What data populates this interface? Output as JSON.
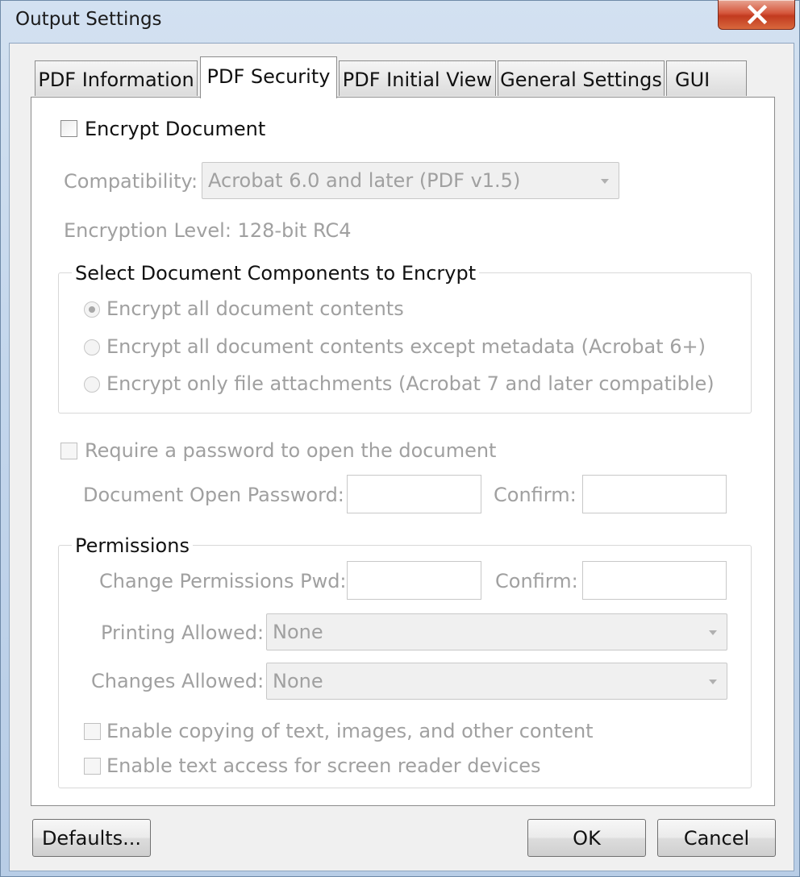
{
  "window": {
    "title": "Output Settings",
    "close_glyph": "✕"
  },
  "tabs": [
    {
      "label": "PDF Information"
    },
    {
      "label": "PDF Security"
    },
    {
      "label": "PDF Initial View"
    },
    {
      "label": "General Settings"
    },
    {
      "label": "GUI"
    }
  ],
  "security": {
    "encrypt_document": {
      "label": "Encrypt Document",
      "checked": false
    },
    "compatibility": {
      "label": "Compatibility:",
      "value": "Acrobat 6.0 and later (PDF v1.5)"
    },
    "encryption_level": "Encryption Level: 128-bit RC4",
    "components": {
      "legend": "Select Document Components to Encrypt",
      "options": [
        {
          "label": "Encrypt all document contents",
          "selected": true
        },
        {
          "label": "Encrypt all document contents except metadata (Acrobat 6+)",
          "selected": false
        },
        {
          "label": "Encrypt only file attachments (Acrobat 7 and later compatible)",
          "selected": false
        }
      ]
    },
    "require_password": {
      "label": "Require a password to open the document",
      "checked": false
    },
    "open_password": {
      "label": "Document Open Password:",
      "value": "",
      "confirm_label": "Confirm:",
      "confirm_value": ""
    },
    "permissions": {
      "legend": "Permissions",
      "change_pwd": {
        "label": "Change Permissions Pwd:",
        "value": "",
        "confirm_label": "Confirm:",
        "confirm_value": ""
      },
      "printing": {
        "label": "Printing Allowed:",
        "value": "None"
      },
      "changes": {
        "label": "Changes Allowed:",
        "value": "None"
      },
      "enable_copying": {
        "label": "Enable copying of text, images, and other content",
        "checked": false
      },
      "enable_screen_reader": {
        "label": "Enable text access for screen reader devices",
        "checked": false
      }
    }
  },
  "buttons": {
    "defaults": "Defaults...",
    "ok": "OK",
    "cancel": "Cancel"
  },
  "colors": {
    "disabled_text": "#a0a0a0",
    "close_button": "#c8432a"
  }
}
